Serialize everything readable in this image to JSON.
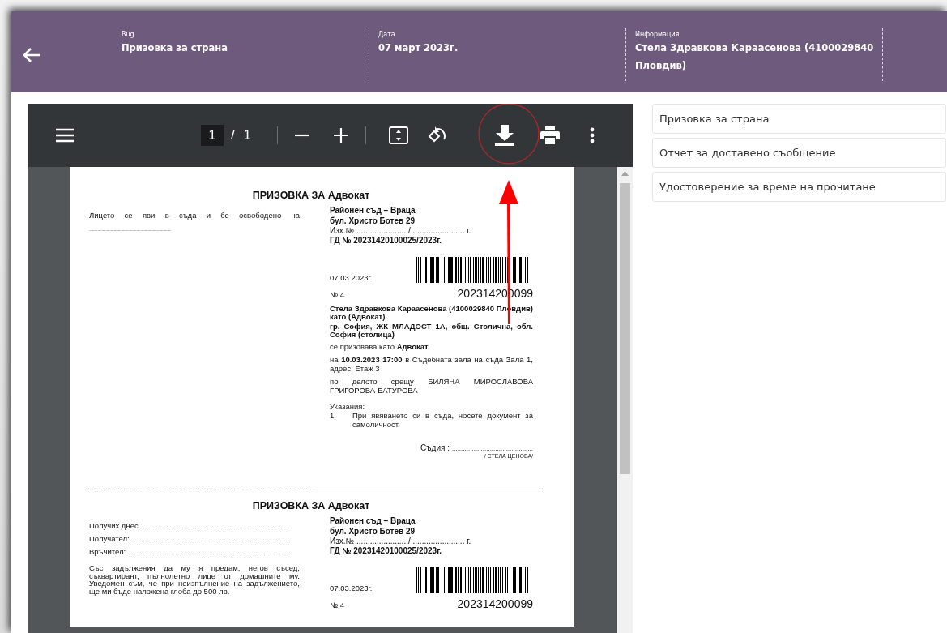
{
  "header": {
    "fields": [
      {
        "label": "Bug",
        "value": "Призовка за страна"
      },
      {
        "label": "Дата",
        "value": "07 март 2023г."
      },
      {
        "label": "Информация",
        "value": "Стела Здравкова Караасенова (4100029840 Пловдив)"
      }
    ]
  },
  "pdf_toolbar": {
    "page_current": "1",
    "page_total": "/ 1"
  },
  "summonses": [
    {
      "title": "ПРИЗОВКА ЗА Адвокат",
      "left": [
        {
          "kind": "spread",
          "text": "Лицето се яви в съда и бе освободено на"
        },
        {
          "kind": "dots",
          "text": "................................................................................"
        }
      ],
      "court": [
        {
          "kind": "bold",
          "text": "Районен съд – Враца"
        },
        {
          "kind": "bold",
          "text": "бул. Христо Ботев 29"
        },
        {
          "kind": "plain",
          "text": "Изх.№ ......................./ ....................... г."
        },
        {
          "kind": "bold",
          "text": "ГД № 20231420100025/2023г."
        }
      ],
      "date": "07.03.2023г.",
      "number": "№ 4",
      "barcode_number": "202314200099",
      "body": [
        {
          "kind": "bold",
          "text": "Стела Здравкова Караасенова (4100029840 Пловдив) като (Адвокат)"
        },
        {
          "kind": "bold",
          "text": "гр. София, ЖК МЛАДОСТ 1А, общ. Столична, обл. София (столица)"
        },
        {
          "kind": "plain",
          "text": "се призовава като **Адвокат**"
        },
        {
          "kind": "plain",
          "text": "на **10.03.2023 17:00** в Съдебната зала на съда Зала 1, адрес: Етаж 3"
        },
        {
          "kind": "plain",
          "text": "по делото срещу БИЛЯНА МИРОСЛАВОВА ГРИГОРОВА-БАТУРОВА"
        },
        {
          "kind": "heading",
          "text": "Указания:"
        },
        {
          "kind": "numbered",
          "marker": "1.",
          "text": "При явяването си в съда, носете документ за самоличност."
        }
      ],
      "signature": {
        "label": "Съдия :",
        "line": ".............................................",
        "name": "/ СТЕЛА ЦЕНОВА/"
      }
    },
    {
      "title": "ПРИЗОВКА ЗА Адвокат",
      "left": [
        {
          "kind": "field",
          "text": "Получих днес ......................................................................"
        },
        {
          "kind": "field",
          "text": "Получател: ..........................................................................."
        },
        {
          "kind": "field",
          "text": "Връчител: ............................................................................"
        },
        {
          "kind": "paragraph",
          "text": "Със задължения да му я предам, негов съсед, съквартирант, пълнолетно лице от домашните му. Уведомен съм, че при неизпълнение на задължението, ще ми бъде наложена глоба до 500 лв."
        }
      ],
      "court": [
        {
          "kind": "bold",
          "text": "Районен съд – Враца"
        },
        {
          "kind": "bold",
          "text": "бул. Христо Ботев 29"
        },
        {
          "kind": "plain",
          "text": "Изх.№ ......................./ ....................... г."
        },
        {
          "kind": "bold",
          "text": "ГД № 20231420100025/2023г."
        }
      ],
      "date": "07.03.2023г.",
      "number": "№ 4",
      "barcode_number": "202314200099"
    }
  ],
  "attachments": [
    {
      "label": "Призовка за страна"
    },
    {
      "label": "Отчет за доставено съобщение"
    },
    {
      "label": "Удостоверение за време на прочитане"
    }
  ]
}
